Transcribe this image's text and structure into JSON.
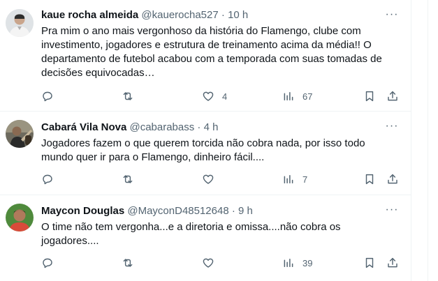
{
  "tweets": [
    {
      "name": "kaue rocha almeida",
      "handle": "@kauerocha527",
      "dot": "·",
      "time": "10 h",
      "text": "Pra mim o ano mais vergonhoso da história do Flamengo, clube com\ninvestimento, jogadores e estrutura de treinamento acima da média!! O\ndepartamento de futebol acabou com a temporada com suas tomadas de\ndecisões equivocadas…",
      "likes": "4",
      "views": "67",
      "avatar_icon": "user-avatar-icon"
    },
    {
      "name": "Cabará Vila Nova",
      "handle": "@cabarabass",
      "dot": "·",
      "time": "4 h",
      "text": "Jogadores fazem o que querem torcida não cobra nada, por isso todo\nmundo quer ir para o Flamengo, dinheiro fácil....",
      "likes": "",
      "views": "7",
      "avatar_icon": "user-avatar-icon"
    },
    {
      "name": "Maycon Douglas",
      "handle": "@MayconD48512648",
      "dot": "·",
      "time": "9 h",
      "text": "O time não tem vergonha...e a diretoria e omissa....não cobra os\njogadores....",
      "likes": "",
      "views": "39",
      "avatar_icon": "user-avatar-icon"
    }
  ],
  "more_label": "···",
  "colors": {
    "text": "#0f1419",
    "secondary": "#536471",
    "border": "#eff3f4"
  }
}
